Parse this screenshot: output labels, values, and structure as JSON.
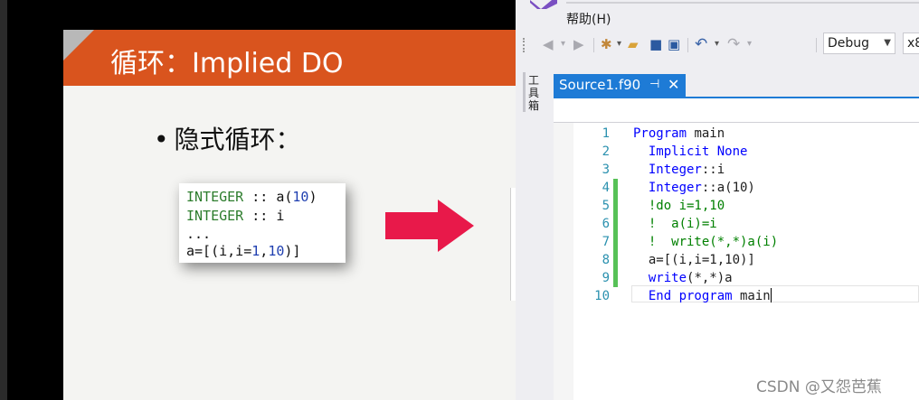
{
  "slide": {
    "title": "循环：Implied DO",
    "bullet_dot": "•",
    "bullet": "隐式循环：",
    "code": {
      "line1_kw": "INTEGER",
      "line1_rest": " :: a(",
      "line1_num": "10",
      "line1_end": ")",
      "line2_kw": "INTEGER",
      "line2_rest": " :: i",
      "line3": "...",
      "line4_a": "a=[(i,i=",
      "line4_n1": "1",
      "line4_c": ",",
      "line4_n2": "10",
      "line4_end": ")]"
    },
    "colors": {
      "header": "#d9541e",
      "arrow": "#e8194a"
    }
  },
  "ide": {
    "menu": {
      "help": "帮助(H)"
    },
    "toolbar": {
      "icons": [
        "back-icon",
        "forward-icon",
        "new-item-icon",
        "open-file-icon",
        "save-icon",
        "save-all-icon",
        "undo-icon",
        "redo-icon"
      ],
      "config": "Debug",
      "platform": "x8"
    },
    "toolbox_label": "工具箱",
    "tab": {
      "title": "Source1.f90",
      "pin": "⊣",
      "close": "✕"
    },
    "lines": [
      {
        "n": "1",
        "parts": [
          {
            "t": "Program",
            "c": "blue"
          },
          {
            "t": " main",
            "c": "plain"
          }
        ]
      },
      {
        "n": "2",
        "parts": [
          {
            "t": "  Implicit None",
            "c": "blue"
          }
        ]
      },
      {
        "n": "3",
        "parts": [
          {
            "t": "  Integer",
            "c": "blue"
          },
          {
            "t": "::i",
            "c": "plain"
          }
        ]
      },
      {
        "n": "4",
        "parts": [
          {
            "t": "  Integer",
            "c": "blue"
          },
          {
            "t": "::a(10)",
            "c": "plain"
          }
        ]
      },
      {
        "n": "5",
        "parts": [
          {
            "t": "  !do i=1,10",
            "c": "green"
          }
        ]
      },
      {
        "n": "6",
        "parts": [
          {
            "t": "  !  a(i)=i",
            "c": "green"
          }
        ]
      },
      {
        "n": "7",
        "parts": [
          {
            "t": "  !  write(*,*)a(i)",
            "c": "green"
          }
        ]
      },
      {
        "n": "8",
        "parts": [
          {
            "t": "  a=[(i,i=1,10)]",
            "c": "plain"
          }
        ]
      },
      {
        "n": "9",
        "parts": [
          {
            "t": "  write",
            "c": "blue"
          },
          {
            "t": "(*,*)a",
            "c": "plain"
          }
        ]
      },
      {
        "n": "10",
        "parts": [
          {
            "t": "  End program",
            "c": "blue"
          },
          {
            "t": " main",
            "c": "plain"
          }
        ]
      }
    ],
    "changed_lines": [
      "4",
      "5",
      "6",
      "7",
      "8",
      "9"
    ]
  },
  "watermark": "CSDN @又怨芭蕉"
}
